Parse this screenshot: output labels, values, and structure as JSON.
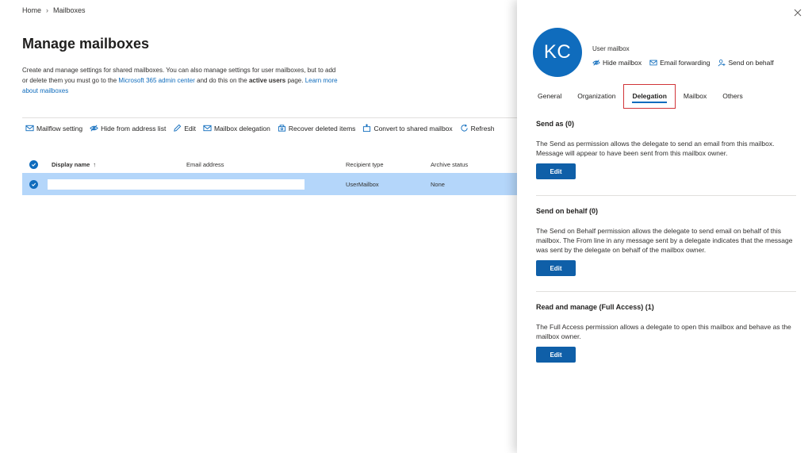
{
  "breadcrumb": {
    "home": "Home",
    "current": "Mailboxes"
  },
  "page": {
    "title": "Manage mailboxes",
    "desc_part1": "Create and manage settings for shared mailboxes. You can also manage settings for user mailboxes, but to add or delete them you must go to the ",
    "desc_link": "Microsoft 365 admin center",
    "desc_part2": " and do this on the ",
    "desc_bold": "active users",
    "desc_part3": " page. ",
    "desc_learn": "Learn more about mailboxes"
  },
  "toolbar": {
    "mailflow": "Mailflow setting",
    "hide": "Hide from address list",
    "edit": "Edit",
    "delegation": "Mailbox delegation",
    "recover": "Recover deleted items",
    "convert": "Convert to shared mailbox",
    "refresh": "Refresh"
  },
  "table": {
    "headers": {
      "display_name": "Display name",
      "sort_arrow": "↑",
      "email": "Email address",
      "recipient_type": "Recipient type",
      "archive": "Archive status"
    },
    "row": {
      "recipient_type": "UserMailbox",
      "archive": "None"
    }
  },
  "panel": {
    "initials": "KC",
    "type": "User mailbox",
    "actions": {
      "hide": "Hide mailbox",
      "forwarding": "Email forwarding",
      "send_behalf": "Send on behalf"
    },
    "tabs": [
      "General",
      "Organization",
      "Delegation",
      "Mailbox",
      "Others"
    ],
    "sections": {
      "send_as": {
        "title": "Send as (0)",
        "text": "The Send as permission allows the delegate to send an email from this mailbox. Message will appear to have been sent from this mailbox owner.",
        "button": "Edit"
      },
      "send_on_behalf": {
        "title": "Send on behalf (0)",
        "text": "The Send on Behalf permission allows the delegate to send email on behalf of this mailbox. The From line in any message sent by a delegate indicates that the message was sent by the delegate on behalf of the mailbox owner.",
        "button": "Edit"
      },
      "full_access": {
        "title": "Read and manage (Full Access) (1)",
        "text": "The Full Access permission allows a delegate to open this mailbox and behave as the mailbox owner.",
        "button": "Edit"
      }
    }
  },
  "colors": {
    "accent": "#0f6cbd",
    "selected_row": "#b4d6fa",
    "highlight_box": "#d13438"
  }
}
